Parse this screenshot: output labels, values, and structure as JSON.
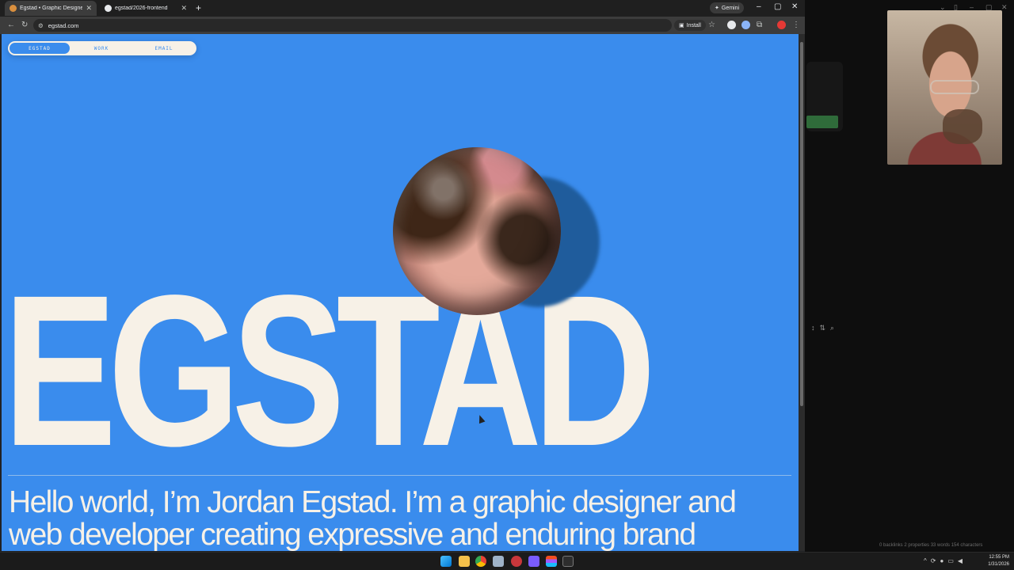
{
  "browser": {
    "tabs": [
      {
        "title": "Egstad • Graphic Designer & D",
        "active": true
      },
      {
        "title": "egstad/2026-frontend",
        "active": false
      }
    ],
    "gemini_label": "Gemini",
    "url": "egstad.com",
    "install_label": "Install"
  },
  "site": {
    "nav": [
      "EGSTAD",
      "WORK",
      "EMAIL"
    ],
    "hero_word": "EGSTAD",
    "intro_line1": "Hello world, I’m Jordan Egstad. I’m a graphic designer and",
    "intro_line2": "web developer creating expressive and enduring brand",
    "colors": {
      "background": "#3a8ced",
      "text": "#f7f1e7"
    }
  },
  "side_app": {
    "status": "0 backlinks   2 properties   33 words   154 characters"
  },
  "taskbar": {
    "time": "12:55 PM",
    "date": "1/31/2026"
  },
  "icons": [
    "back-icon",
    "reload-icon",
    "star-icon",
    "extensions-icon",
    "windows-start-icon",
    "file-explorer-icon",
    "chrome-icon",
    "figma-icon",
    "terminal-icon"
  ]
}
